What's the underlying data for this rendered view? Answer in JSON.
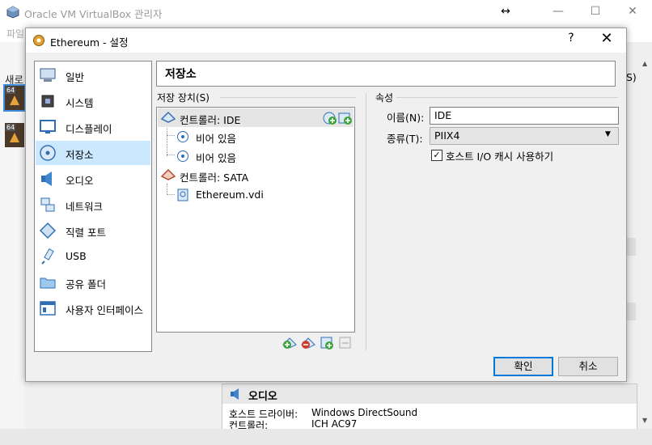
{
  "main_window": {
    "title": "Oracle VM VirtualBox 관리자",
    "menu_first": "파일",
    "toolbar_new": "새로",
    "vm_badge": "64",
    "extra_glyph": "S)",
    "controls": {
      "restore": "↔",
      "minimize": "—",
      "maximize": "☐",
      "close": "✕"
    }
  },
  "audio_panel": {
    "title": "오디오",
    "rows": [
      {
        "label": "호스트 드라이버:",
        "value": "Windows DirectSound"
      },
      {
        "label": "컨트롤러:",
        "value": "ICH AC97"
      }
    ]
  },
  "dialog": {
    "title": "Ethereum - 설정",
    "help": "?",
    "close": "✕",
    "sidebar": [
      {
        "label": "일반",
        "icon": "general-icon"
      },
      {
        "label": "시스템",
        "icon": "system-chip-icon"
      },
      {
        "label": "디스플레이",
        "icon": "display-monitor-icon"
      },
      {
        "label": "저장소",
        "icon": "storage-disk-icon",
        "selected": true
      },
      {
        "label": "오디오",
        "icon": "speaker-icon"
      },
      {
        "label": "네트워크",
        "icon": "network-icon"
      },
      {
        "label": "직렬 포트",
        "icon": "serial-port-icon"
      },
      {
        "label": "USB",
        "icon": "usb-icon"
      },
      {
        "label": "공유 폴더",
        "icon": "folder-icon"
      },
      {
        "label": "사용자 인터페이스",
        "icon": "ui-window-icon"
      }
    ],
    "section_title": "저장소",
    "storage_devices_label": "저장 장치(S)",
    "tree": [
      {
        "label": "컨트롤러: IDE",
        "icon": "ide-controller-icon"
      },
      {
        "label": "비어 있음",
        "icon": "optical-disc-icon"
      },
      {
        "label": "비어 있음",
        "icon": "optical-disc-icon"
      },
      {
        "label": "컨트롤러: SATA",
        "icon": "sata-controller-icon"
      },
      {
        "label": "Ethereum.vdi",
        "icon": "hard-disk-icon"
      }
    ],
    "attributes": {
      "group_label": "속성",
      "name_label": "이름(N):",
      "name_value": "IDE",
      "type_label": "종류(T):",
      "type_value": "PIIX4",
      "cache_label": "호스트 I/O 캐시 사용하기",
      "cache_checked": true
    },
    "ok": "확인",
    "cancel": "취소"
  }
}
